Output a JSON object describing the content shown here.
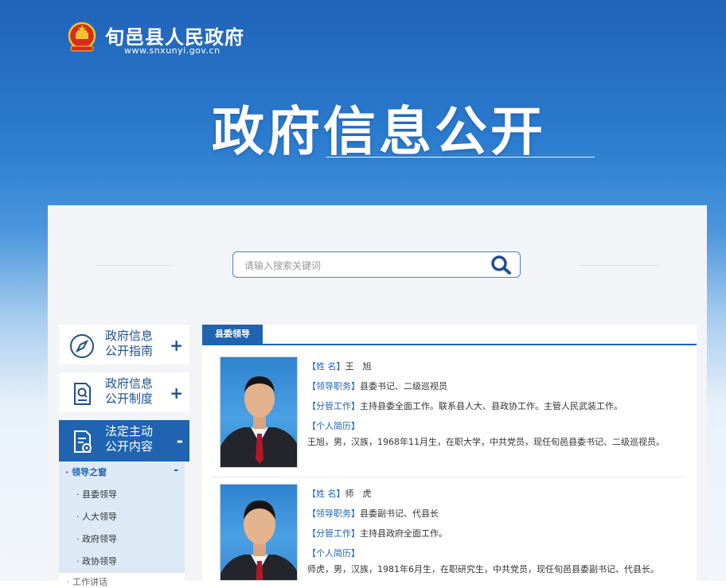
{
  "header": {
    "site_name": "旬邑县人民政府",
    "site_url": "www.snxunyi.gov.cn",
    "main_title": "政府信息公开"
  },
  "search": {
    "placeholder": "请输入搜索关键词"
  },
  "sidebar": {
    "items": [
      {
        "label_line1": "政府信息",
        "label_line2": "公开指南",
        "toggle": "+"
      },
      {
        "label_line1": "政府信息",
        "label_line2": "公开制度",
        "toggle": "+"
      },
      {
        "label_line1": "法定主动",
        "label_line2": "公开内容",
        "toggle": "-"
      }
    ],
    "submenu": {
      "title": "· 领导之窗",
      "toggle": "-",
      "items": [
        "· 县委领导",
        "· 人大领导",
        "· 政府领导",
        "· 政协领导"
      ],
      "next_item": "· 工作讲话"
    }
  },
  "content": {
    "tab_label": "县委领导",
    "leaders": [
      {
        "name_key": "【姓 名】",
        "name": "王　旭",
        "position_key": "【领导职务】",
        "position": "县委书记、二级巡视员",
        "duty_key": "【分管工作】",
        "duty": "主持县委全面工作。联系县人大、县政协工作。主管人民武装工作。",
        "bio_key": "【个人简历】",
        "bio": "王旭，男，汉族，1968年11月生，在职大学，中共党员，现任旬邑县委书记、二级巡视员。"
      },
      {
        "name_key": "【姓 名】",
        "name": "师　虎",
        "position_key": "【领导职务】",
        "position": "县委副书记、代县长",
        "duty_key": "【分管工作】",
        "duty": "主持县政府全面工作。",
        "bio_key": "【个人简历】",
        "bio": "师虎，男，汉族，1981年6月生，在职研究生，中共党员，现任旬邑县委副书记、代县长。"
      }
    ]
  },
  "colors": {
    "primary": "#1f63b1",
    "submenu_bg": "#ddeaf6",
    "panel_bg": "#f2f4f7"
  }
}
